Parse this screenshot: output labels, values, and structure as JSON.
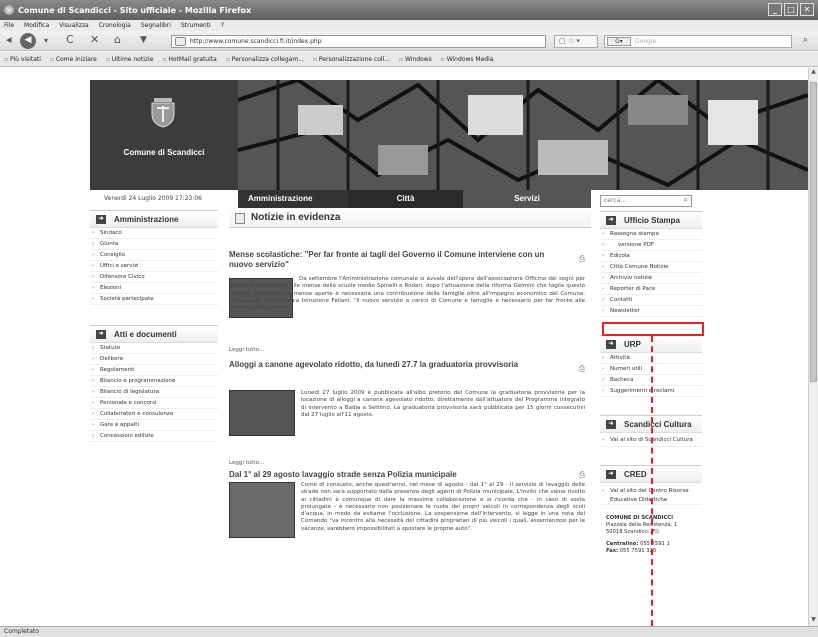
{
  "browser": {
    "title": "Comune di Scandicci - Sito ufficiale - Mozilla Firefox",
    "menu": [
      "File",
      "Modifica",
      "Visualizza",
      "Cronologia",
      "Segnalibri",
      "Strumenti",
      "?"
    ],
    "url": "http://www.comune.scandicci.fi.it/index.php",
    "search_placeholder": "Google",
    "search_engine": "G▾",
    "bookmarks": [
      "Più visitati",
      "Come iniziare",
      "Ultime notizie",
      "HotMail gratuita",
      "Personalizza collegam...",
      "Personalizzazione coll...",
      "Windows",
      "Windows Media"
    ],
    "status": "Completato"
  },
  "site": {
    "name": "Comune di Scandicci",
    "date": "Venerdì 24 Luglio 2009 17:23:06",
    "tabs": [
      "Amministrazione",
      "Città",
      "Servizi"
    ],
    "search_placeholder": "cerca...",
    "left_boxes": [
      {
        "title": "Amministrazione",
        "items": [
          "Sindaco",
          "Giunta",
          "Consiglio",
          "Uffici e servizi",
          "Difensore Civico",
          "Elezioni",
          "Società partecipate"
        ]
      },
      {
        "title": "Atti e documenti",
        "items": [
          "Statuto",
          "Delibere",
          "Regolamenti",
          "Bilancio e programmazione",
          "Bilancio di legislatura",
          "Personale e concorsi",
          "Collaboratori e consulenze",
          "Gare e appalti",
          "Concessioni edilizie"
        ]
      }
    ],
    "right_boxes": [
      {
        "title": "Ufficio Stampa",
        "items": [
          "Rassegna stampa",
          "versione PDF",
          "Edicola",
          "Città Comune Notizie",
          "Archivio notizie",
          "Reporter di Pace",
          "Contatti",
          "Newsletter"
        ]
      },
      {
        "title": "URP",
        "items": [
          "Attività",
          "Numeri utili",
          "Bacheca",
          "Suggerimenti e reclami"
        ]
      },
      {
        "title": "Scandicci Cultura",
        "items": [
          "Vai al sito di Scandicci Cultura"
        ]
      },
      {
        "title": "CRED",
        "items": [
          "Vai al sito del Centro Risorse Educative Didattiche"
        ]
      }
    ],
    "contact": {
      "name": "COMUNE DI SCANDICCI",
      "address": "Piazzale della Resistenza, 1",
      "city": "50018 Scandicci (FI)",
      "phone_label": "Centralino:",
      "phone": "055 7591 1",
      "fax_label": "Fax:",
      "fax": "055 7591 320"
    },
    "news": {
      "title": "Notizie in evidenza",
      "read_more": "Leggi tutto...",
      "articles": [
        {
          "title": "Mense scolastiche: \"Per far fronte ai tagli del Governo il Comune interviene con un nuovo servizio\"",
          "text": "Da settembre l'Amministrazione comunale si avvale dell'opera dell'associazione Officina dei sogni per garantire l'assistenza alle mense delle scuole medie Spinelli e Rodari, dopo l'attuazione della riforma Gelmini che taglia questo servizio. Per tenere le mense aperte è necessaria una contribuzione delle famiglie oltre all'impegno economico del Comune. L'assessore alla Pubblica Istruzione Feliani: \"Il nuovo servizio a carico di Comune e famiglie è necessario per far fronte alle decisioni del Governo\"."
        },
        {
          "title": "Alloggi a canone agevolato ridotto, da lunedì 27.7 la graduatoria provvisoria",
          "text": "Lunedì 27 luglio 2009 è pubblicata all'albo pretorio del Comune la graduatoria provvisoria per la locazione di alloggi a canone agevolato ridotto, direttamente dall'attuatore del Programma integrato di intervento a Badia a Settimo. La graduatoria provvisoria sarà pubblicata per 15 giorni consecutivi dal 27 luglio all'11 agosto."
        },
        {
          "title": "Dal 1° al 29 agosto lavaggio strade senza Polizia municipale",
          "text": "Come di consueto, anche quest'anno, nel mese di agosto - dal 1° al 29 - il servizio di lavaggio delle strade non sarà supportato dalla presenza degli agenti di Polizia municipale. L'invito che viene rivolto ai cittadini è comunque di dare la massima collaborazione e si ricorda che - in caso di sosta prolungata - è necessario non posizionare le ruote dei propri veicoli in corrispondenza degli scoli d'acqua, in modo da evitarne l'occlusione. La sospensione dell'intervento, si legge in una nota del Comando \"va incontro alla necessità dei cittadini proprietari di più veicoli i quali, assentandosi per le vacanze, sarebbero impossibilitati a spostare le proprie auto\"."
        }
      ]
    }
  }
}
